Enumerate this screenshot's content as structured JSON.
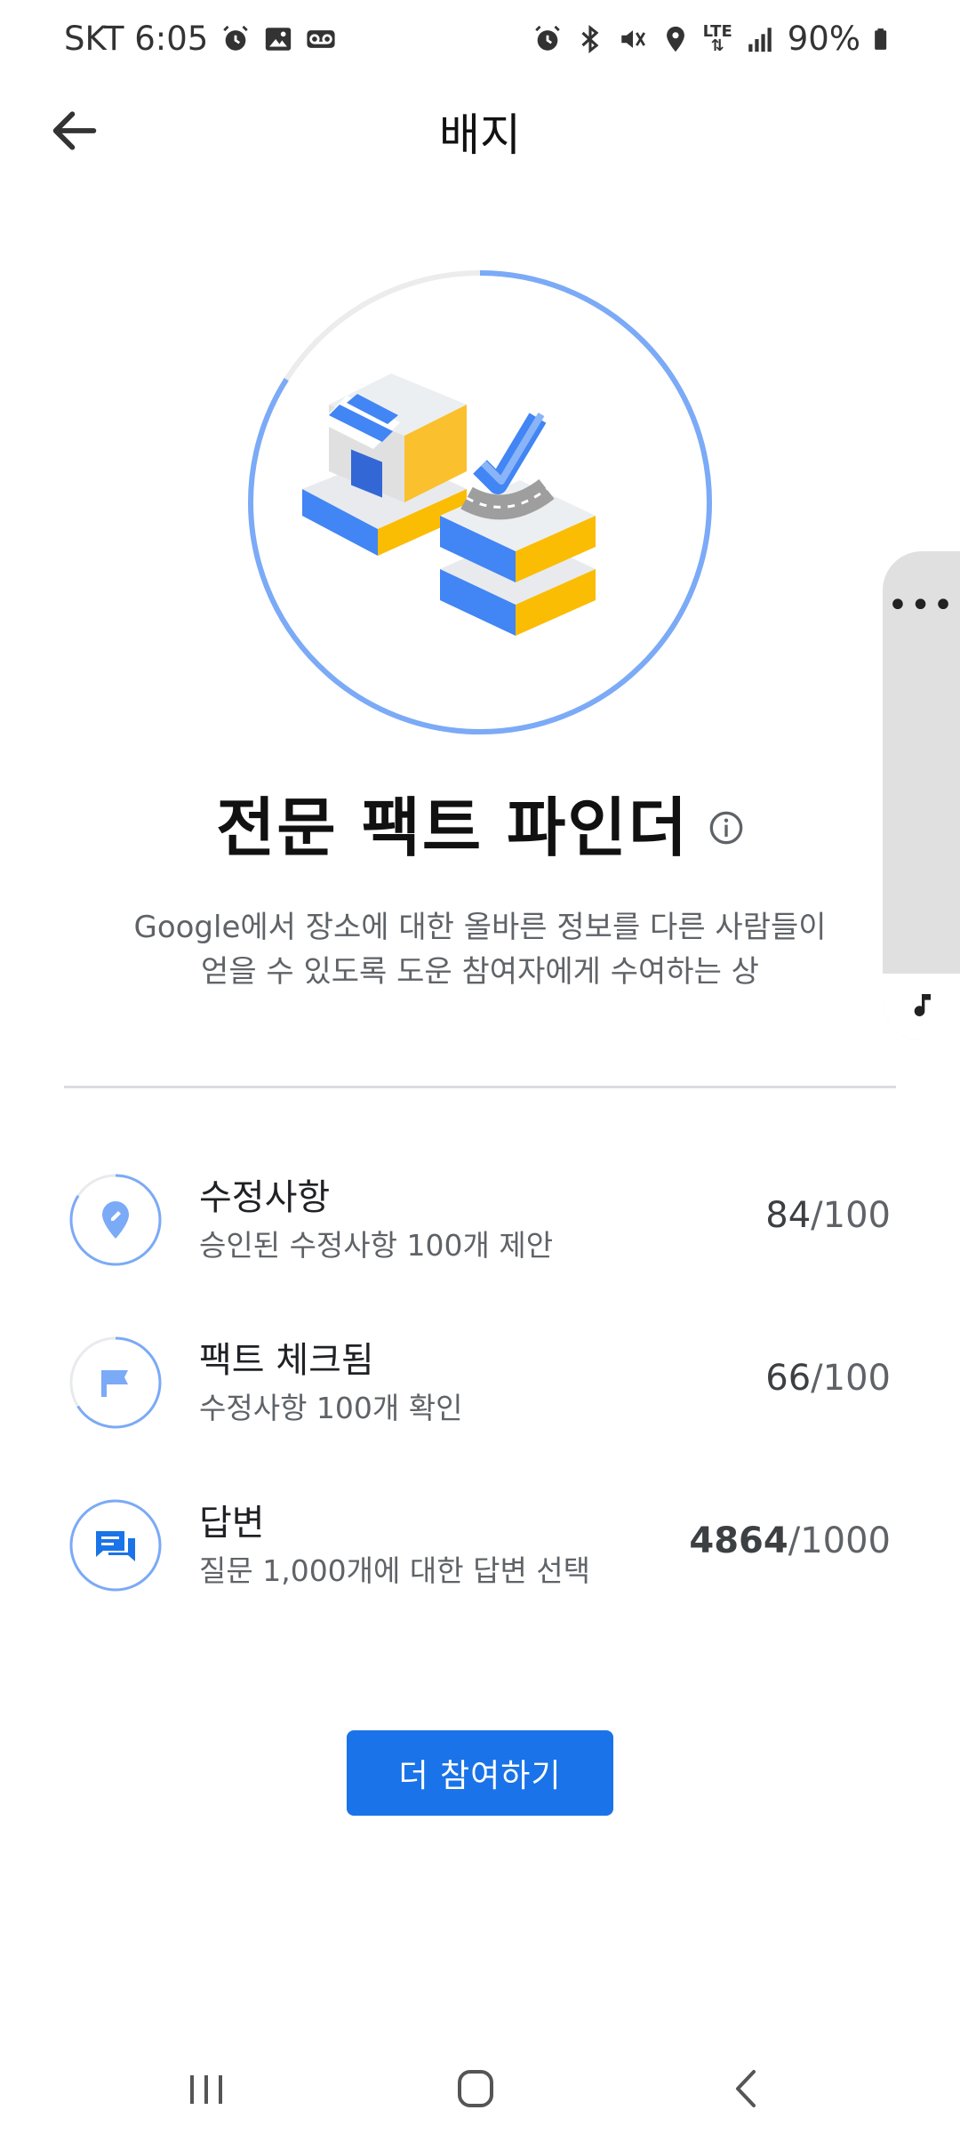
{
  "status_bar": {
    "carrier_time": "SKT 6:05",
    "network": "LTE",
    "battery": "90%",
    "icons_left": [
      "alarm-icon",
      "image-icon",
      "voicemail-icon"
    ],
    "icons_right": [
      "alarm-icon",
      "bluetooth-icon",
      "mute-icon",
      "location-icon",
      "lte-icon",
      "signal-icon",
      "battery-icon"
    ]
  },
  "app_bar": {
    "title": "배지",
    "back_icon": "arrow-back-icon"
  },
  "badge": {
    "name": "전문 팩트 파인더",
    "description": "Google에서 장소에 대한 올바른 정보를 다른 사람들이\n얻을 수 있도록 도운 참여자에게 수여하는 상",
    "progress_fraction": 0.84,
    "accent_color": "#7baaf7"
  },
  "progress_items": [
    {
      "icon": "edit-pin-icon",
      "title": "수정사항",
      "subtitle": "승인된 수정사항 100개 제안",
      "current": "84",
      "target": "/100",
      "fraction": 0.84
    },
    {
      "icon": "flag-icon",
      "title": "팩트 체크됨",
      "subtitle": "수정사항 100개 확인",
      "current": "66",
      "target": "/100",
      "fraction": 0.66
    },
    {
      "icon": "answers-icon",
      "title": "답변",
      "subtitle": "질문 1,000개에 대한 답변 선택",
      "current": "4864",
      "target": "/1000",
      "fraction": 1.0
    }
  ],
  "cta": {
    "label": "더 참여하기",
    "color": "#1a73e8"
  },
  "side_panel": {
    "more": "•••"
  }
}
